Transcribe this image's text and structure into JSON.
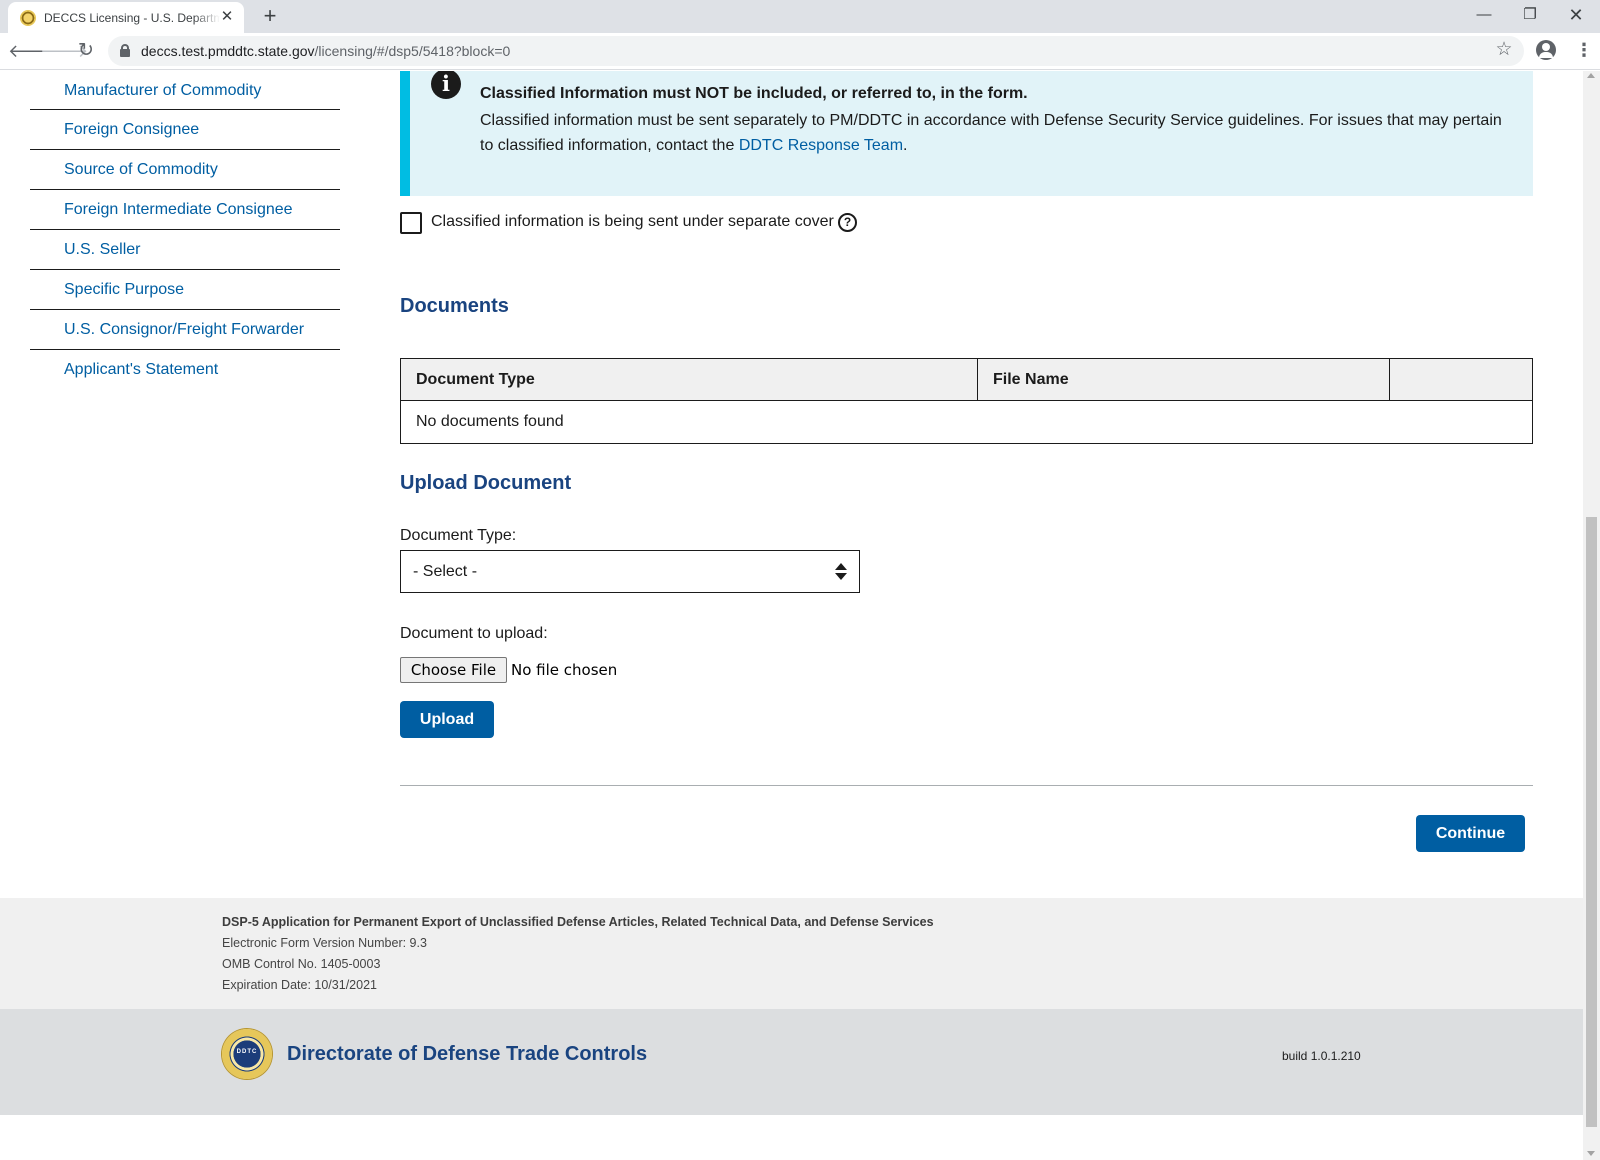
{
  "browser": {
    "tab_title": "DECCS Licensing - U.S. Department of State",
    "new_tab": "+",
    "url_host": "deccs.test.pmddtc.state.gov",
    "url_path": "/licensing/#/dsp5/5418?block=0",
    "window_controls": {
      "minimize": "—",
      "restore": "❐",
      "close": "✕"
    },
    "icons": [
      "back-arrow-icon",
      "forward-arrow-icon",
      "reload-icon",
      "lock-icon",
      "star-icon",
      "profile-icon",
      "menu-icon"
    ]
  },
  "sidenav": {
    "items": [
      "Manufacturer of Commodity",
      "Foreign Consignee",
      "Source of Commodity",
      "Foreign Intermediate Consignee",
      "U.S. Seller",
      "Specific Purpose",
      "U.S. Consignor/Freight Forwarder",
      "Applicant's Statement"
    ]
  },
  "alert": {
    "icon": "i",
    "heading": "Classified Information must NOT be included, or referred to, in the form.",
    "body": "Classified information must be sent separately to PM/DDTC in accordance with Defense Security Service guidelines. For issues that may pertain to classified information, contact the",
    "link": "DDTC Response Team",
    "end": ".",
    "colors": {
      "background": "#e1f3f8",
      "border": "#00bde3"
    }
  },
  "classified_checkbox": {
    "label": "Classified information is being sent under separate cover",
    "checked": false,
    "help_icon": "?"
  },
  "documents": {
    "title": "Documents",
    "columns": [
      "Document Type",
      "File Name",
      ""
    ],
    "empty_text": "No documents found"
  },
  "upload": {
    "title": "Upload Document",
    "type_label": "Document Type:",
    "type_value": "- Select -",
    "file_label": "Document to upload:",
    "choose_file": "Choose File",
    "no_file": "No file chosen",
    "upload_button": "Upload"
  },
  "actions": {
    "continue": "Continue"
  },
  "footer": {
    "form_title": "DSP-5 Application for Permanent Export of Unclassified Defense Articles, Related Technical Data, and Defense Services",
    "version": "Electronic Form Version Number: 9.3",
    "omb": "OMB Control No. 1405-0003",
    "expiration": "Expiration Date: 10/31/2021",
    "seal_text": "DDTC",
    "agency": "Directorate of Defense Trade Controls",
    "build": "build 1.0.1.210"
  },
  "theme": {
    "link": "#005ea2",
    "heading": "#1a4480",
    "primary_button": "#005ea2"
  }
}
